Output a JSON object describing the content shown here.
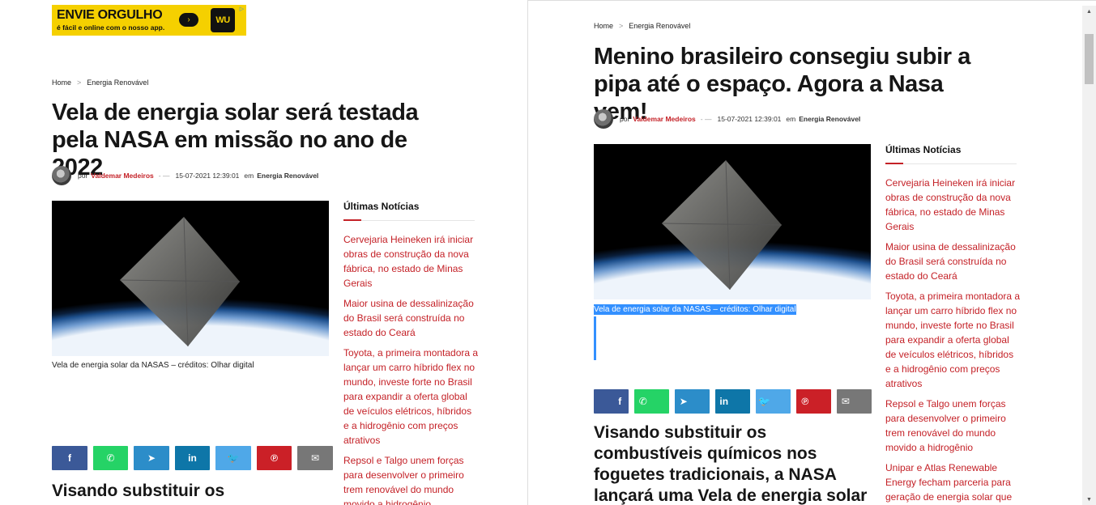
{
  "left": {
    "ad": {
      "title": "ENVIE ORGULHO",
      "subtitle": "é fácil e online com o nosso app.",
      "arrow": "›",
      "logo": "WU",
      "choices_icon": "ad-choices-icon"
    },
    "breadcrumb": {
      "home": "Home",
      "separator": ">",
      "category": "Energia Renovável"
    },
    "title": "Vela de energia solar será testada pela NASA em missão no ano de 2022",
    "meta": {
      "by": "por",
      "author": "Valdemar Medeiros",
      "dash": "- —",
      "date": "15-07-2021 12:39:01",
      "in": "em",
      "category": "Energia Renovável"
    },
    "image_caption": "Vela de energia solar da NASAS – créditos: Olhar digital",
    "share": [
      {
        "network": "facebook",
        "icon": "f"
      },
      {
        "network": "whatsapp",
        "icon": "✆"
      },
      {
        "network": "telegram",
        "icon": "➤"
      },
      {
        "network": "linkedin",
        "icon": "in"
      },
      {
        "network": "twitter",
        "icon": "🐦"
      },
      {
        "network": "pinterest",
        "icon": "℗"
      },
      {
        "network": "email",
        "icon": "✉"
      }
    ],
    "subhead": "Visando substituir os",
    "sidebar": {
      "title": "Últimas Notícias",
      "items": [
        "Cervejaria Heineken irá iniciar obras de construção da nova fábrica, no estado de Minas Gerais",
        "Maior usina de dessalinização do Brasil será construída no estado do Ceará",
        "Toyota, a primeira montadora a lançar um carro híbrido flex no mundo, investe forte no Brasil para expandir a oferta global de veículos elétricos, híbridos e a hidrogênio com preços atrativos",
        "Repsol e Talgo unem forças para desenvolver o primeiro trem renovável do mundo movido a hidrogênio"
      ]
    }
  },
  "right": {
    "breadcrumb": {
      "home": "Home",
      "separator": ">",
      "category": "Energia Renovável"
    },
    "title": "Menino brasileiro consegiu subir a pipa até o espaço. Agora a Nasa vem!",
    "meta": {
      "by": "por",
      "author": "Valdemar Medeiros",
      "dash": "- —",
      "date": "15-07-2021 12:39:01",
      "in": "em",
      "category": "Energia Renovável"
    },
    "image_caption": "Vela de energia solar da NASAS – créditos: Olhar digital",
    "subhead": "Visando substituir os combustíveis químicos nos foguetes tradicionais, a NASA lançará uma Vela de energia solar",
    "sidebar": {
      "title": "Últimas Notícias",
      "items": [
        "Cervejaria Heineken irá iniciar obras de construção da nova fábrica, no estado de Minas Gerais",
        "Maior usina de dessalinização do Brasil será construída no estado do Ceará",
        "Toyota, a primeira montadora a lançar um carro híbrido flex no mundo, investe forte no Brasil para expandir a oferta global de veículos elétricos, híbridos e a hidrogênio com preços atrativos",
        "Repsol e Talgo unem forças para desenvolver o primeiro trem renovável do mundo movido a hidrogênio",
        "Unipar e Atlas Renewable Energy fecham parceria para geração de energia solar que"
      ]
    },
    "scrollbar": {
      "up_icon": "▲",
      "down_icon": "▼"
    }
  },
  "colors": {
    "accent": "#c42127",
    "selection": "#3390ff",
    "ad_yellow": "#f5d000"
  }
}
